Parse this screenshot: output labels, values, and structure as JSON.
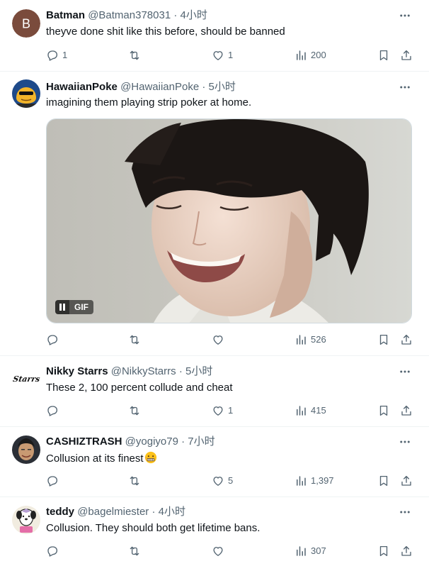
{
  "tweets": [
    {
      "name": "Batman",
      "handle": "@Batman378031",
      "sep": "·",
      "time": "4小时",
      "text": "theyve done shit like this before, should be banned",
      "avatar_letter": "B",
      "replies": "1",
      "retweets": "",
      "likes": "1",
      "views": "200"
    },
    {
      "name": "HawaiianPoke",
      "handle": "@HawaiianPoke",
      "sep": "·",
      "time": "5小时",
      "text": "imagining them playing strip poker at home.",
      "media_badge": "GIF",
      "replies": "",
      "retweets": "",
      "likes": "",
      "views": "526"
    },
    {
      "name": "Nikky Starrs",
      "handle": "@NikkyStarrs",
      "sep": "·",
      "time": "5小时",
      "text": "These 2, 100 percent collude and cheat",
      "avatar_text": "Starrs",
      "replies": "",
      "retweets": "",
      "likes": "1",
      "views": "415"
    },
    {
      "name": "CASHIZTRASH",
      "handle": "@yogiyo79",
      "sep": "·",
      "time": "7小时",
      "text": "Collusion at its finest",
      "replies": "",
      "retweets": "",
      "likes": "5",
      "views": "1,397"
    },
    {
      "name": "teddy",
      "handle": "@bagelmiester",
      "sep": "·",
      "time": "4小时",
      "text": "Collusion. They should both get lifetime bans.",
      "replies": "",
      "retweets": "",
      "likes": "",
      "views": "307"
    }
  ],
  "colors": {
    "text_primary": "#0f1419",
    "text_secondary": "#536471",
    "divider": "#eff3f4",
    "batman_avatar": "#7a4b3c"
  },
  "icons": [
    "more-icon",
    "reply-icon",
    "retweet-icon",
    "like-icon",
    "views-icon",
    "bookmark-icon",
    "share-icon",
    "pause-icon",
    "grimace-emoji"
  ]
}
